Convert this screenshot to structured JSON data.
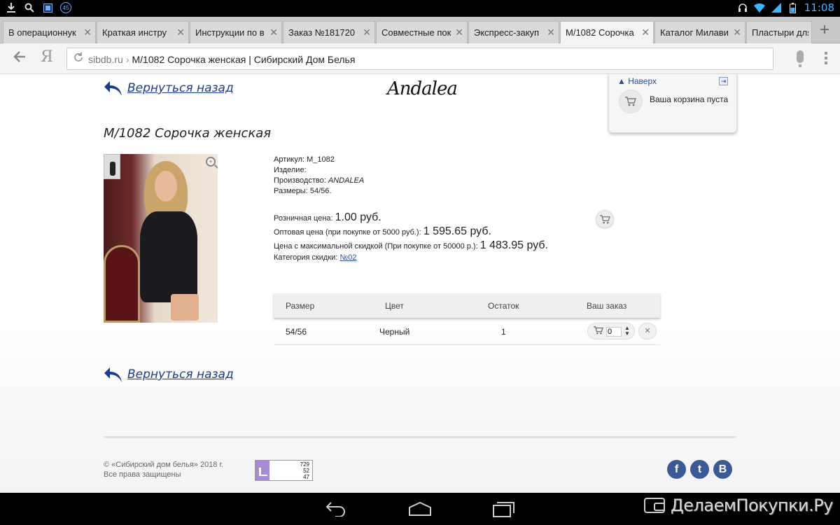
{
  "status_bar": {
    "notification_badge": "45",
    "time": "11:08"
  },
  "tabs": [
    {
      "label": "В операционнук",
      "active": false
    },
    {
      "label": "Краткая инстру",
      "active": false
    },
    {
      "label": "Инструкции по в",
      "active": false
    },
    {
      "label": "Заказ №181720",
      "active": false
    },
    {
      "label": "Совместные пок",
      "active": false
    },
    {
      "label": "Экспресс-закуп",
      "active": false
    },
    {
      "label": "М/1082 Сорочка",
      "active": true
    },
    {
      "label": "Каталог Милави",
      "active": false
    },
    {
      "label": "Пластыри для",
      "active": false
    }
  ],
  "tab_close_glyph": "✕",
  "new_tab_glyph": "+",
  "address_bar": {
    "domain": "sibdb.ru",
    "separator": "›",
    "page_title": "М/1082 Сорочка женская | Сибирский Дом Белья",
    "yandex_glyph": "Я"
  },
  "back_link_label": "Вернуться назад",
  "brand_logo_text": "Andalea",
  "cart_widget": {
    "up_label": "Наверх",
    "empty_label": "Ваша корзина пуста"
  },
  "product": {
    "title": "М/1082 Сорочка женская",
    "article_label": "Артикул:",
    "article_value": "М_1082",
    "item_label": "Изделие:",
    "item_value": "",
    "maker_label": "Производство:",
    "maker_value": "ANDALEA",
    "sizes_label": "Размеры:",
    "sizes_value": "54/56."
  },
  "prices": {
    "retail_label": "Розничная цена:",
    "retail_value": "1.00 руб.",
    "wholesale_label": "Оптовая цена (при покупке от 5000 руб.):",
    "wholesale_value": "1 595.65 руб.",
    "max_discount_label": "Цена с максимальной скидкой (При покупке от 50000 р.):",
    "max_discount_value": "1 483.95 руб.",
    "category_label": "Категория скидки:",
    "category_value": "№02"
  },
  "size_table": {
    "headers": [
      "Размер",
      "Цвет",
      "Остаток",
      "Ваш заказ"
    ],
    "rows": [
      {
        "size": "54/56",
        "color": "Черный",
        "stock": "1",
        "qty": "0"
      }
    ]
  },
  "footer": {
    "copyright_line1": "© «Сибирский дом белья» 2018 г.",
    "copyright_line2": "Все права защищены",
    "counter": [
      "729",
      "52",
      "47"
    ],
    "social": [
      "f",
      "t",
      "B"
    ]
  },
  "watermark": "ДелаемПокупки.Ру",
  "colors": {
    "link": "#1a3c8c",
    "accent_time": "#3cb4ff",
    "social_bg": "#3a5a96"
  }
}
